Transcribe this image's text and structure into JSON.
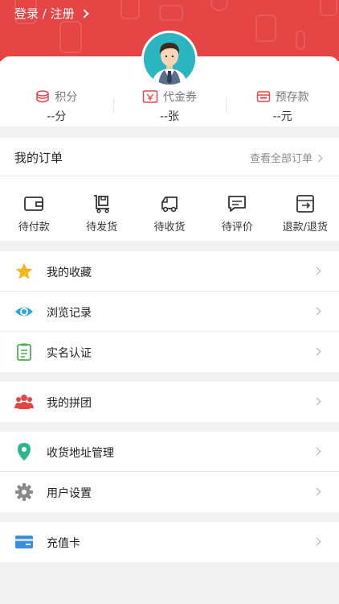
{
  "header": {
    "login_label": "登录 / 注册",
    "bg_color": "#e64545"
  },
  "stats": [
    {
      "label": "积分",
      "value": "--分",
      "icon": "coins-icon"
    },
    {
      "label": "代金券",
      "value": "--张",
      "icon": "voucher-icon"
    },
    {
      "label": "预存款",
      "value": "--元",
      "icon": "wallet-icon"
    }
  ],
  "orders": {
    "title": "我的订单",
    "view_all": "查看全部订单",
    "items": [
      {
        "label": "待付款",
        "icon": "wallet-icon"
      },
      {
        "label": "待发货",
        "icon": "cart-box-icon"
      },
      {
        "label": "待收货",
        "icon": "truck-icon"
      },
      {
        "label": "待评价",
        "icon": "comment-icon"
      },
      {
        "label": "退款/退货",
        "icon": "return-icon"
      }
    ]
  },
  "menu": [
    {
      "label": "我的收藏",
      "icon": "star-icon"
    },
    {
      "label": "浏览记录",
      "icon": "eye-icon"
    },
    {
      "label": "实名认证",
      "icon": "id-doc-icon"
    },
    {
      "label": "我的拼团",
      "icon": "group-icon"
    },
    {
      "label": "收货地址管理",
      "icon": "location-pin-icon"
    },
    {
      "label": "用户设置",
      "icon": "gear-icon"
    },
    {
      "label": "充值卡",
      "icon": "card-icon"
    }
  ],
  "colors": {
    "accent": "#e64545",
    "star": "#f5b820",
    "eye": "#2aa7d9",
    "id_doc": "#4caf50",
    "group": "#e64545",
    "pin": "#2bb58a",
    "gear": "#8a8a8a",
    "card": "#3a8fe0"
  }
}
